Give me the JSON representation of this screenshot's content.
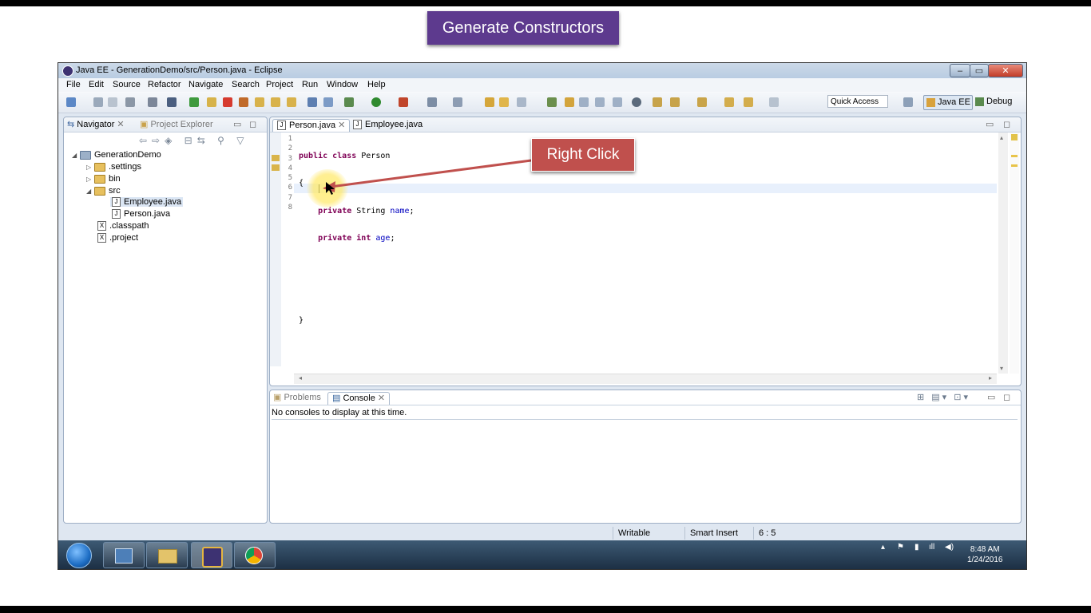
{
  "banner": {
    "title": "Generate Constructors"
  },
  "callout": {
    "label": "Right Click"
  },
  "window": {
    "title": "Java EE - GenerationDemo/src/Person.java - Eclipse",
    "controls": {
      "minimize": "–",
      "maximize": "▭",
      "close": "✕"
    }
  },
  "menu": [
    "File",
    "Edit",
    "Source",
    "Refactor",
    "Navigate",
    "Search",
    "Project",
    "Run",
    "Window",
    "Help"
  ],
  "toolbar": {
    "quick_access_placeholder": "Quick Access",
    "perspective_java": "Java EE",
    "perspective_debug": "Debug"
  },
  "navigator": {
    "tab_navigator": "Navigator",
    "tab_project_explorer": "Project Explorer",
    "tree": [
      {
        "label": "GenerationDemo",
        "type": "project",
        "expanded": true
      },
      {
        "label": ".settings",
        "type": "folder",
        "expanded": false
      },
      {
        "label": "bin",
        "type": "folder",
        "expanded": false
      },
      {
        "label": "src",
        "type": "folder",
        "expanded": true
      },
      {
        "label": "Employee.java",
        "type": "java"
      },
      {
        "label": "Person.java",
        "type": "java"
      },
      {
        "label": ".classpath",
        "type": "xml"
      },
      {
        "label": ".project",
        "type": "xml"
      }
    ]
  },
  "editor": {
    "tabs": [
      "Person.java",
      "Employee.java"
    ],
    "active_tab": "Person.java",
    "line_numbers": [
      "1",
      "2",
      "3",
      "4",
      "5",
      "6",
      "7",
      "8"
    ],
    "code": {
      "l1_kw": "public class",
      "l1_name": " Person",
      "l2": "{",
      "l3_kw": "private",
      "l3_type": " String ",
      "l3_field": "name",
      "l3_end": ";",
      "l4_kw1": "private",
      "l4_kw2": "int",
      "l4_field": "age",
      "l4_end": ";",
      "l7": "}"
    }
  },
  "console": {
    "tab_problems": "Problems",
    "tab_console": "Console",
    "message": "No consoles to display at this time."
  },
  "status": {
    "writable": "Writable",
    "insert_mode": "Smart Insert",
    "position": "6 : 5"
  },
  "taskbar": {
    "time": "8:48 AM",
    "date": "1/24/2016"
  },
  "colors": {
    "banner_bg": "#5d3a8e",
    "callout_bg": "#c0504d",
    "keyword": "#7f0055",
    "field": "#0000c0"
  }
}
